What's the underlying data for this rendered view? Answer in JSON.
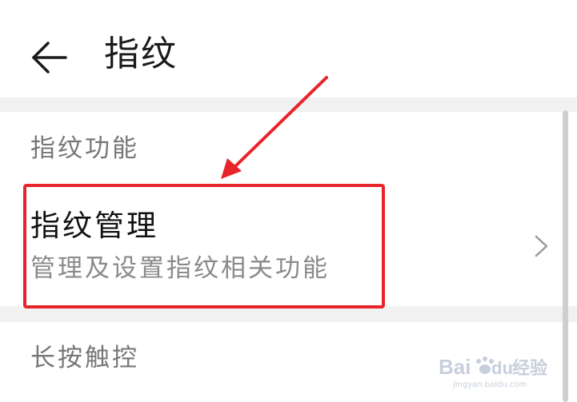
{
  "header": {
    "title": "指纹",
    "back_icon": "arrow-left-icon"
  },
  "sections": [
    {
      "label": "指纹功能",
      "items": [
        {
          "title": "指纹管理",
          "subtitle": "管理及设置指纹相关功能",
          "trailing_icon": "chevron-right-icon"
        }
      ]
    },
    {
      "label": "长按触控"
    }
  ],
  "annotation": {
    "color": "#e8242b"
  },
  "watermark": {
    "text_latin": "Bai",
    "text_latin_2": "du",
    "text_cn": "经验",
    "url": "jingyan.baidu.com"
  }
}
